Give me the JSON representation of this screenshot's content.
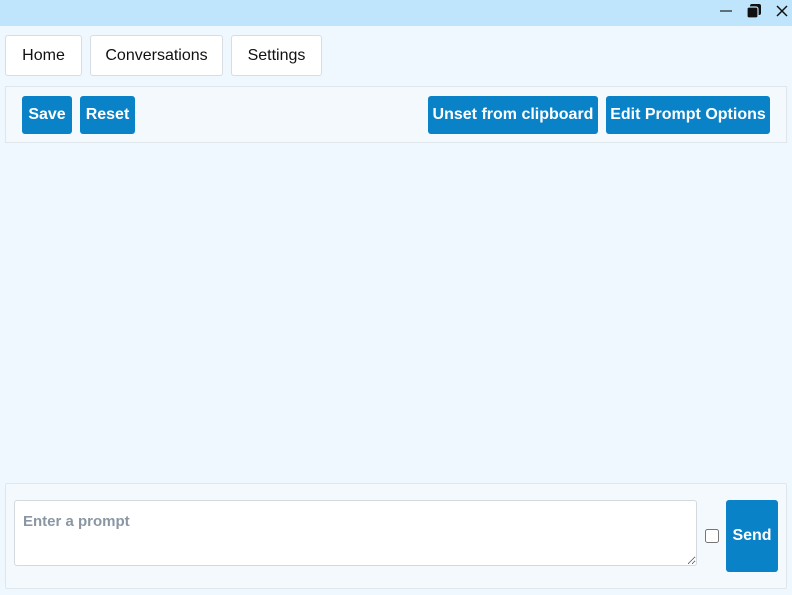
{
  "window": {
    "controls": {
      "minimize_icon": "minimize-icon",
      "maximize_icon": "restore-icon",
      "close_icon": "close-icon"
    }
  },
  "tabs": [
    {
      "label": "Home"
    },
    {
      "label": "Conversations"
    },
    {
      "label": "Settings"
    }
  ],
  "toolbar": {
    "save_label": "Save",
    "reset_label": "Reset",
    "unset_label": "Unset from clipboard",
    "edit_prompt_label": "Edit Prompt Options"
  },
  "prompt": {
    "placeholder": "Enter a prompt",
    "value": "",
    "checkbox_checked": false,
    "send_label": "Send"
  },
  "colors": {
    "titlebar": "#bee5fb",
    "background": "#f0f8ff",
    "accent": "#0a82c8"
  }
}
